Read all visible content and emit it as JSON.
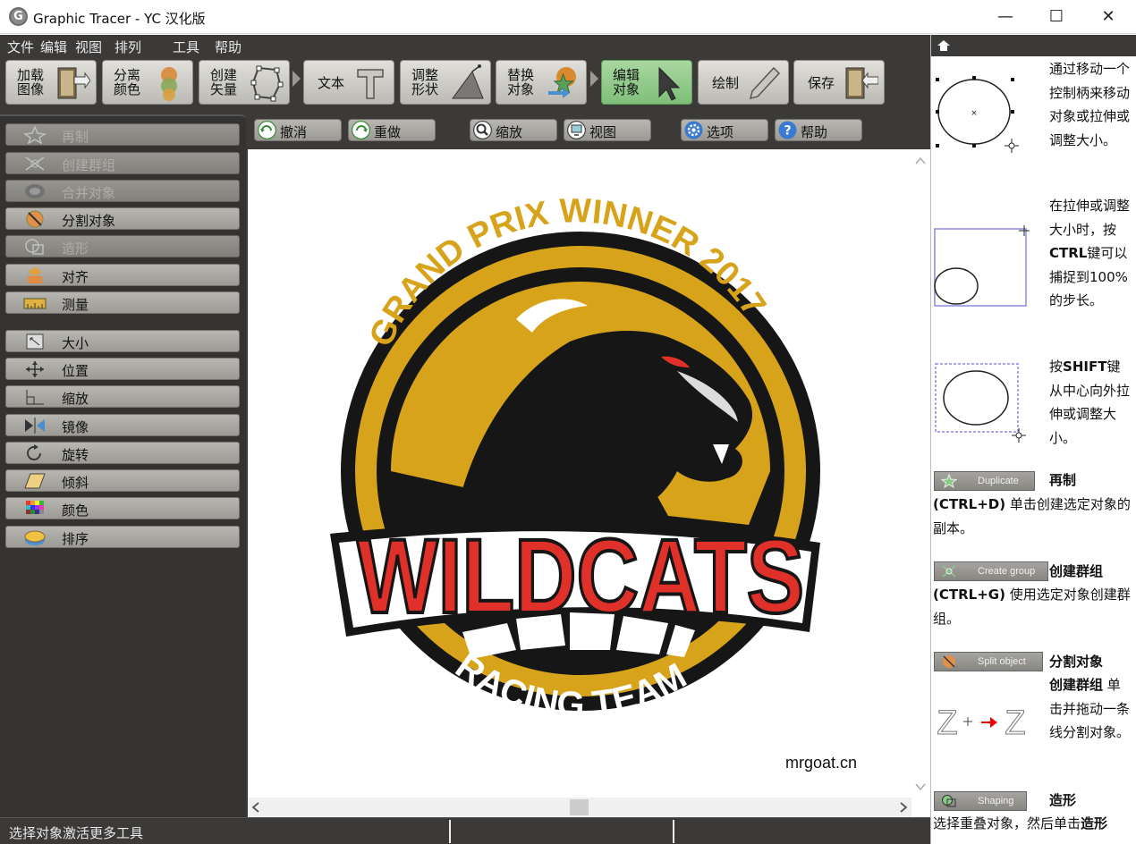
{
  "window": {
    "title": "Graphic Tracer - YC 汉化版",
    "app_icon_letter": "G",
    "minimize": "—",
    "maximize": "☐",
    "close": "✕"
  },
  "menu": [
    "文件",
    "编辑",
    "视图",
    "排列",
    "工具",
    "帮助"
  ],
  "main_toolbar": [
    {
      "label": "加载\n图像",
      "icon": "load-image-icon"
    },
    {
      "label": "分离\n颜色",
      "icon": "separate-colors-icon"
    },
    {
      "label": "创建\n矢量",
      "icon": "create-vector-icon"
    },
    {
      "label": "文本",
      "icon": "text-icon"
    },
    {
      "label": "调整\n形状",
      "icon": "adjust-shape-icon"
    },
    {
      "label": "替换\n对象",
      "icon": "replace-object-icon"
    },
    {
      "label": "编辑\n对象",
      "icon": "edit-object-icon",
      "active": true
    },
    {
      "label": "绘制",
      "icon": "draw-icon"
    },
    {
      "label": "保存",
      "icon": "save-icon"
    }
  ],
  "left_tools": [
    {
      "label": "再制",
      "enabled": false,
      "icon": "duplicate-icon"
    },
    {
      "label": "创建群组",
      "enabled": false,
      "icon": "create-group-icon"
    },
    {
      "label": "合并对象",
      "enabled": false,
      "icon": "merge-objects-icon"
    },
    {
      "label": "分割对象",
      "enabled": true,
      "icon": "split-object-icon"
    },
    {
      "label": "造形",
      "enabled": false,
      "icon": "shaping-icon"
    },
    {
      "label": "对齐",
      "enabled": true,
      "icon": "align-icon"
    },
    {
      "label": "测量",
      "enabled": true,
      "icon": "measure-icon"
    },
    {
      "label": "大小",
      "enabled": true,
      "icon": "size-icon"
    },
    {
      "label": "位置",
      "enabled": true,
      "icon": "position-icon"
    },
    {
      "label": "缩放",
      "enabled": true,
      "icon": "scale-icon"
    },
    {
      "label": "镜像",
      "enabled": true,
      "icon": "mirror-icon"
    },
    {
      "label": "旋转",
      "enabled": true,
      "icon": "rotate-icon"
    },
    {
      "label": "倾斜",
      "enabled": true,
      "icon": "skew-icon"
    },
    {
      "label": "颜色",
      "enabled": true,
      "icon": "color-icon"
    },
    {
      "label": "排序",
      "enabled": true,
      "icon": "order-icon"
    }
  ],
  "sub_toolbar": [
    {
      "label": "撤消",
      "icon": "undo-icon"
    },
    {
      "label": "重做",
      "icon": "redo-icon"
    },
    {
      "label": "缩放",
      "icon": "zoom-icon"
    },
    {
      "label": "视图",
      "icon": "view-icon"
    },
    {
      "label": "选项",
      "icon": "options-gear-icon"
    },
    {
      "label": "帮助",
      "icon": "help-icon"
    }
  ],
  "logo": {
    "arc_text": "GRAND PRIX WINNER 2017",
    "main_text": "WILDCATS",
    "bottom_text": "RACING TEAM"
  },
  "watermark": "mrgoat.cn",
  "help_panel": {
    "home_icon": "home-icon",
    "p1": "通过移动一个控制柄来移动对象或拉伸或调整大小。",
    "p2_a": "在拉伸或调整大小时，按",
    "p2_b": "CTRL",
    "p2_c": "键可以捕捉到100%的步长。",
    "p3_a": "按",
    "p3_b": "SHIFT",
    "p3_c": "键从中心向外拉伸或调整大小。",
    "dup_btn": "Duplicate",
    "dup_title": "再制",
    "dup_key": "(CTRL+D)",
    "dup_desc": "单击创建选定对象的副本。",
    "grp_btn": "Create group",
    "grp_title": "创建群组",
    "grp_key": "(CTRL+G)",
    "grp_desc": "使用选定对象创建群组。",
    "split_btn": "Split object",
    "split_title": "分割对象",
    "split_sub": "创建群组",
    "split_desc": "单击并拖动一条线分割对象。",
    "shape_btn": "Shaping",
    "shape_title": "造形",
    "shape_desc_a": "选择重叠对象，然后单击",
    "shape_desc_b": "造形"
  },
  "status": "选择对象激活更多工具",
  "colors": {
    "dark_chrome": "#3c3a38",
    "logo_gold": "#d7a31a",
    "logo_red": "#e0302a",
    "logo_black": "#161616"
  }
}
